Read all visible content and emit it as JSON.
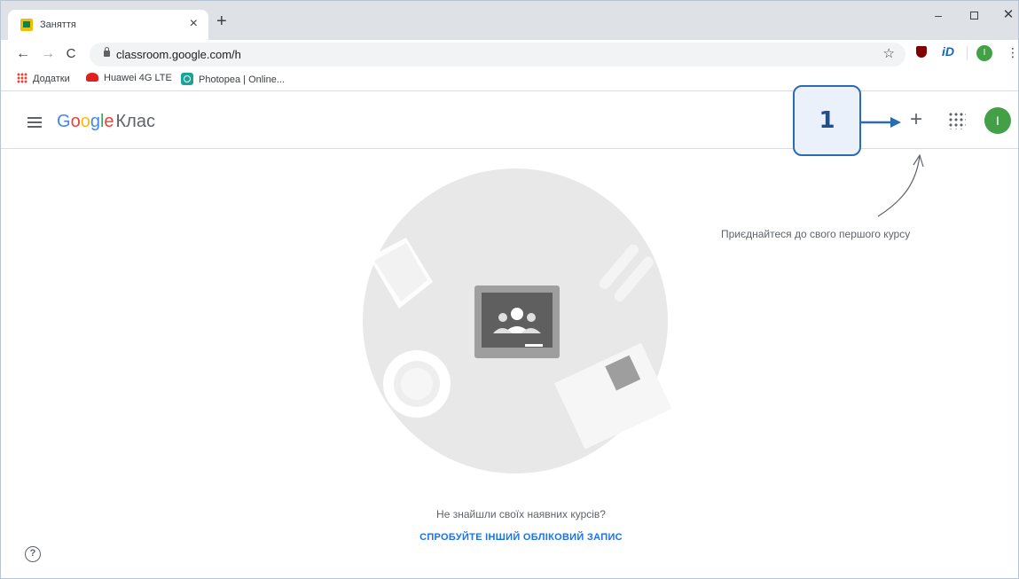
{
  "tab": {
    "title": "Заняття",
    "close": "×",
    "new_tab": "+"
  },
  "window": {
    "minimize": "–",
    "close": "✕"
  },
  "toolbar": {
    "back": "←",
    "forward": "→",
    "reload": "C",
    "url": "classroom.google.com/h",
    "star": "☆",
    "profile_initial": "I",
    "menu": "⋮",
    "ext_id": "iD"
  },
  "bookmarks": [
    {
      "label": "Додатки",
      "icon": "apps-grid-icon"
    },
    {
      "label": "Huawei 4G LTE",
      "icon": "huawei-icon"
    },
    {
      "label": "Photopea | Online...",
      "icon": "photopea-icon"
    }
  ],
  "appbar": {
    "brand_google": [
      "G",
      "o",
      "o",
      "g",
      "l",
      "e"
    ],
    "brand_suffix": "Клас",
    "plus": "+",
    "avatar_initial": "I"
  },
  "annotation": {
    "number": "1"
  },
  "content": {
    "hint": "Приєднайтеся до свого першого курсу",
    "missing": "Не знайшли своїх наявних курсів?",
    "try_other": "СПРОБУЙТЕ ІНШИЙ ОБЛІКОВИЙ ЗАПИС",
    "help": "?"
  },
  "colors": {
    "google_blue": "#4285f4",
    "google_red": "#ea4335",
    "google_yellow": "#fbbc05",
    "google_green": "#34a853",
    "avatar_green": "#43a047",
    "link_blue": "#1a73e8",
    "callout_border": "#2b6cb0"
  }
}
